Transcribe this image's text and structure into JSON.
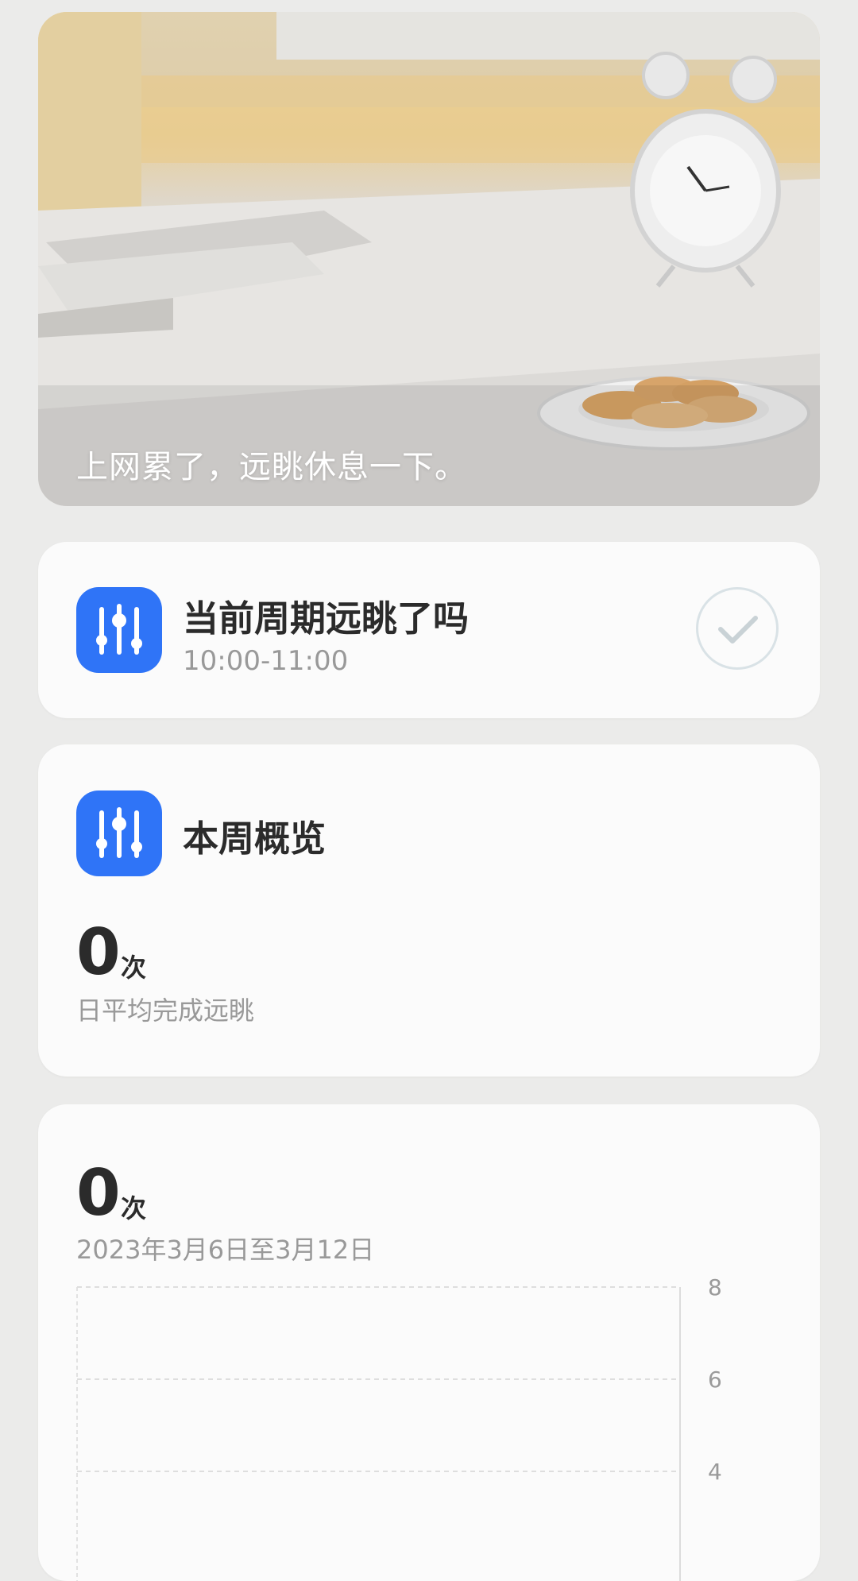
{
  "hero": {
    "caption": "上网累了，远眺休息一下。"
  },
  "current_cycle": {
    "title": "当前周期远眺了吗",
    "time_range": "10:00-11:00",
    "icon": "sliders-icon",
    "check_icon": "checkmark-circle-icon"
  },
  "weekly_overview": {
    "title": "本周概览",
    "icon": "sliders-icon",
    "value": "0",
    "unit": "次",
    "label": "日平均完成远眺"
  },
  "weekly_chart": {
    "value": "0",
    "unit": "次",
    "date_range": "2023年3月6日至3月12日"
  },
  "chart_data": {
    "type": "bar",
    "categories": [],
    "values": [],
    "title": "",
    "xlabel": "",
    "ylabel": "",
    "ylim": [
      0,
      8
    ],
    "y_ticks": [
      "8",
      "6",
      "4"
    ],
    "grid": true
  },
  "colors": {
    "accent": "#2f74f7",
    "background": "#ebebea",
    "card": "#fbfbfb"
  }
}
